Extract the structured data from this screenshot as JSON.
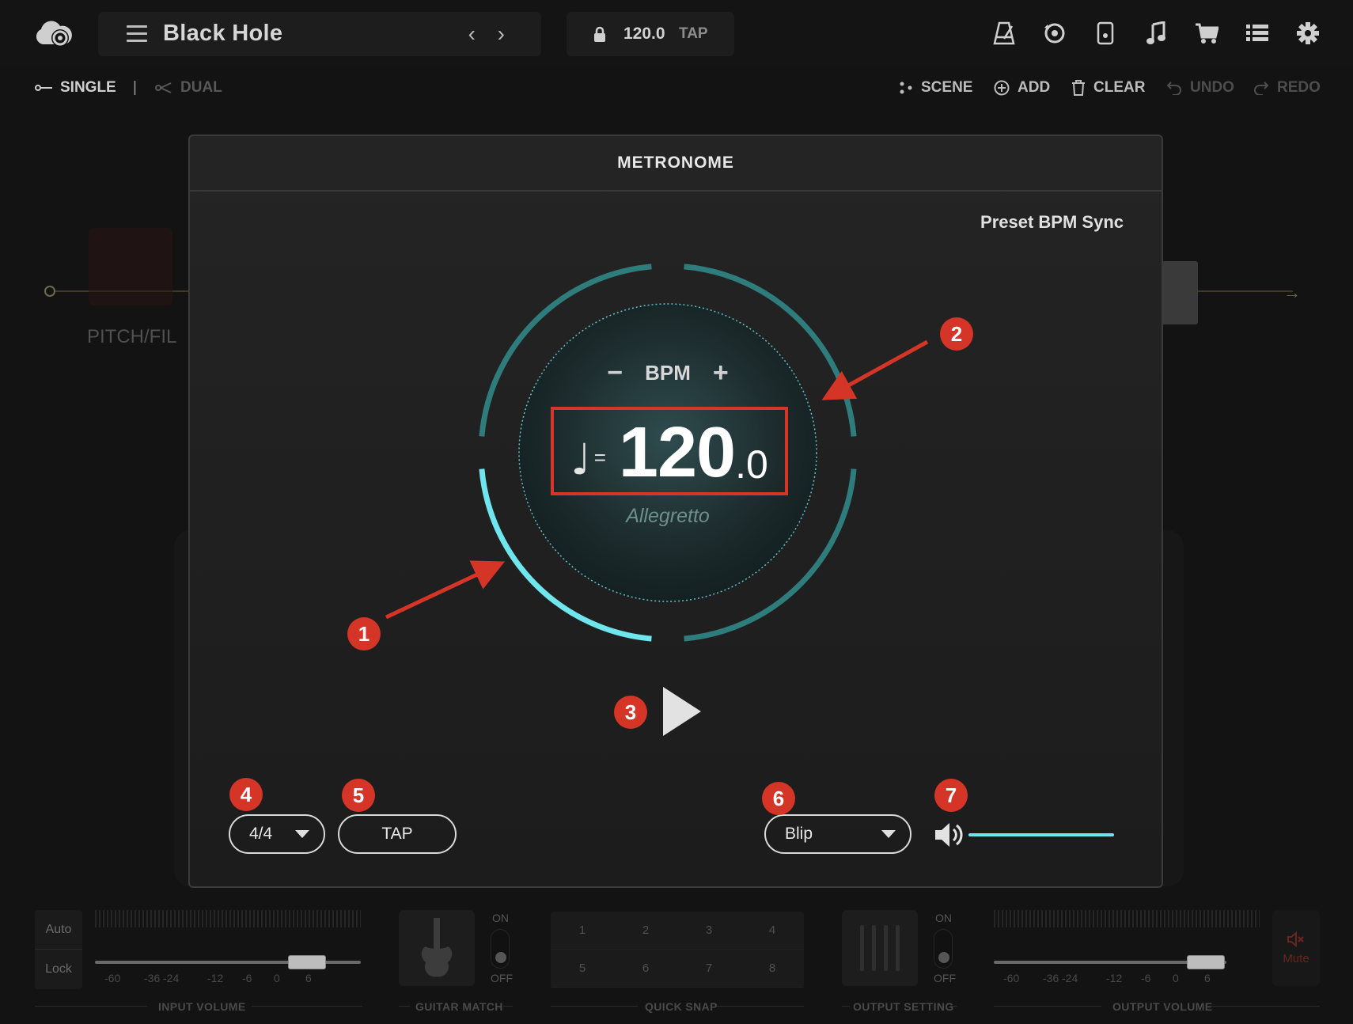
{
  "app": {
    "preset_name": "Black Hole",
    "nav_arrows": "‹ ›",
    "tempo_bpm": "120.0",
    "tap_label": "TAP"
  },
  "toolbar": {
    "single": "SINGLE",
    "separator": "|",
    "dual": "DUAL",
    "scene": "SCENE",
    "add": "ADD",
    "clear": "CLEAR",
    "undo": "UNDO",
    "redo": "REDO"
  },
  "background": {
    "pedal_label": "PITCH/FIL"
  },
  "metronome": {
    "title": "METRONOME",
    "preset_bpm_sync": "Preset BPM Sync",
    "bpm_label": "BPM",
    "minus": "−",
    "plus": "+",
    "note_symbol": "♩",
    "equals": "=",
    "bpm_integer": "120",
    "bpm_fraction": ".0",
    "tempo_marking": "Allegretto",
    "time_signature": "4/4",
    "tap_button": "TAP",
    "sound": "Blip",
    "volume_level": 1.0,
    "beat_progress": 0.25,
    "accent_color": "#6fe6ee",
    "ring_color": "#2e7c7c"
  },
  "annotations": [
    "1",
    "2",
    "3",
    "4",
    "5",
    "6",
    "7"
  ],
  "annotation_color": "#d53527",
  "bottom": {
    "auto": "Auto",
    "lock": "Lock",
    "input_scale": [
      "-60",
      "-36",
      "-24",
      "-12",
      "-6",
      "0",
      "6"
    ],
    "output_scale": [
      "-60",
      "-36",
      "-24",
      "-12",
      "-6",
      "0",
      "6"
    ],
    "input_volume": "INPUT VOLUME",
    "guitar_match": "GUITAR MATCH",
    "quick_snap": "QUICK SNAP",
    "output_setting": "OUTPUT SETTING",
    "output_volume": "OUTPUT VOLUME",
    "on": "ON",
    "off": "OFF",
    "snaps": [
      "1",
      "2",
      "3",
      "4",
      "5",
      "6",
      "7",
      "8"
    ],
    "mute": "Mute"
  }
}
